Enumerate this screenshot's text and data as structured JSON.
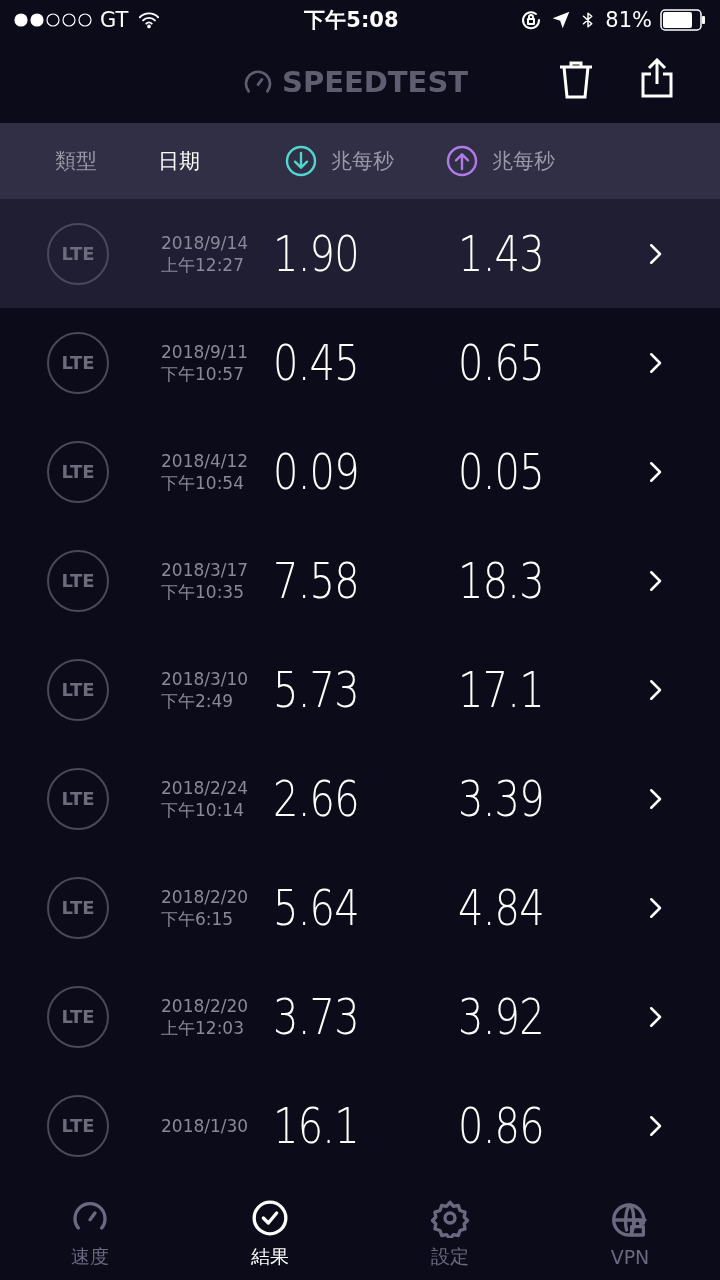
{
  "status_bar": {
    "carrier": "GT",
    "time": "下午5:08",
    "battery": "81%"
  },
  "header": {
    "title": "SPEEDTEST"
  },
  "columns": [
    {
      "label": "類型",
      "kind": "text",
      "selected": false
    },
    {
      "label": "日期",
      "kind": "text",
      "selected": true
    },
    {
      "label": "兆每秒",
      "kind": "download",
      "selected": false
    },
    {
      "label": "兆每秒",
      "kind": "upload",
      "selected": false
    }
  ],
  "results": [
    {
      "type": "LTE",
      "date": "2018/9/14",
      "time": "上午12:27",
      "download": "1.90",
      "upload": "1.43",
      "selected": true
    },
    {
      "type": "LTE",
      "date": "2018/9/11",
      "time": "下午10:57",
      "download": "0.45",
      "upload": "0.65",
      "selected": false
    },
    {
      "type": "LTE",
      "date": "2018/4/12",
      "time": "下午10:54",
      "download": "0.09",
      "upload": "0.05",
      "selected": false
    },
    {
      "type": "LTE",
      "date": "2018/3/17",
      "time": "下午10:35",
      "download": "7.58",
      "upload": "18.3",
      "selected": false
    },
    {
      "type": "LTE",
      "date": "2018/3/10",
      "time": "下午2:49",
      "download": "5.73",
      "upload": "17.1",
      "selected": false
    },
    {
      "type": "LTE",
      "date": "2018/2/24",
      "time": "下午10:14",
      "download": "2.66",
      "upload": "3.39",
      "selected": false
    },
    {
      "type": "LTE",
      "date": "2018/2/20",
      "time": "下午6:15",
      "download": "5.64",
      "upload": "4.84",
      "selected": false
    },
    {
      "type": "LTE",
      "date": "2018/2/20",
      "time": "上午12:03",
      "download": "3.73",
      "upload": "3.92",
      "selected": false
    },
    {
      "type": "LTE",
      "date": "2018/1/30",
      "download": "16.1",
      "upload": "0.86",
      "selected": false
    }
  ],
  "tab_bar": [
    {
      "label": "速度",
      "kind": "speed",
      "selected": false
    },
    {
      "label": "結果",
      "kind": "results",
      "selected": true
    },
    {
      "label": "設定",
      "kind": "settings",
      "selected": false
    },
    {
      "label": "VPN",
      "kind": "vpn",
      "selected": false
    }
  ]
}
